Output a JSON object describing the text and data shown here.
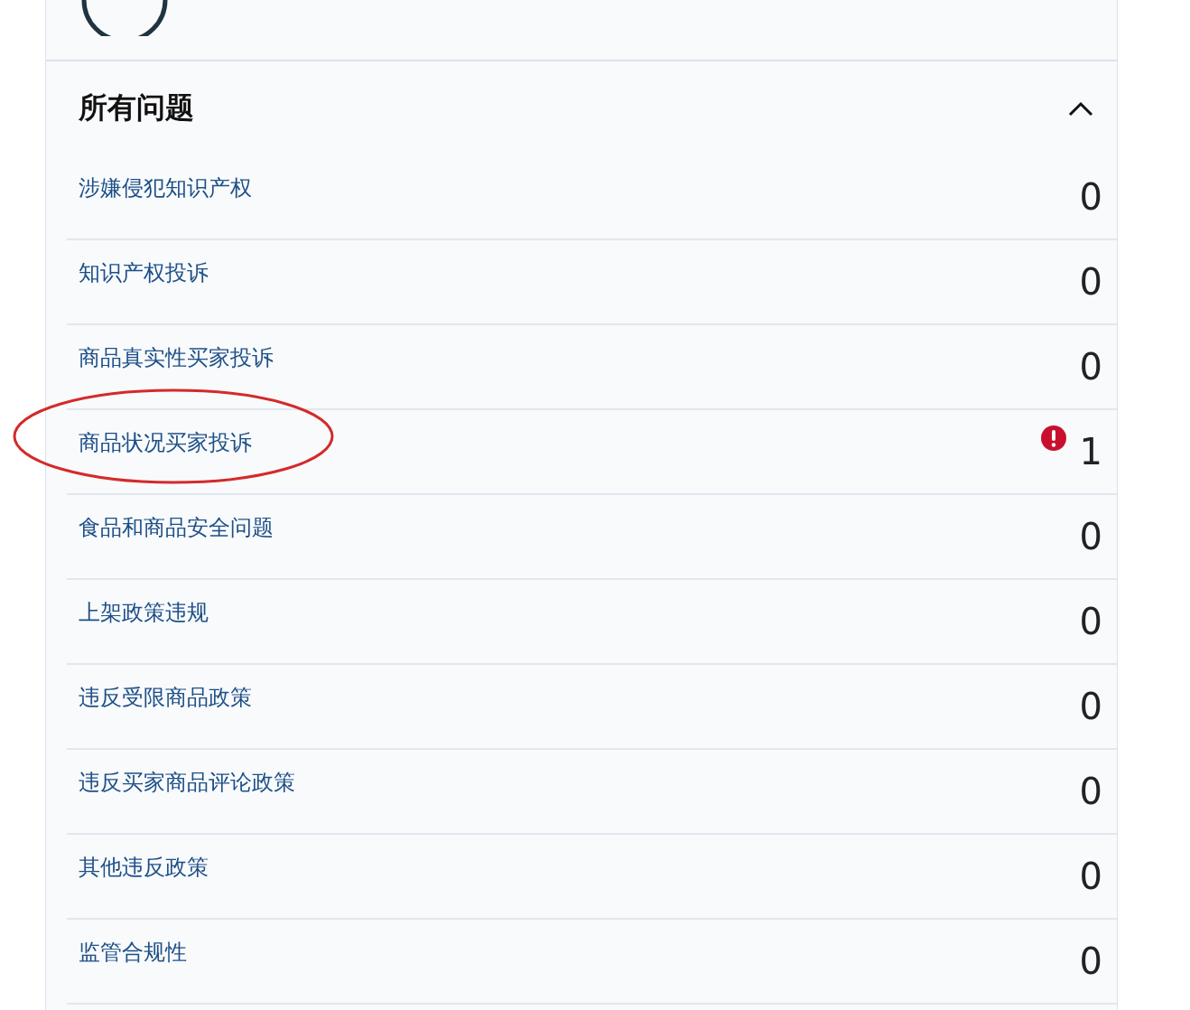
{
  "section": {
    "title": "所有问题",
    "expanded": true
  },
  "items": [
    {
      "label": "涉嫌侵犯知识产权",
      "count": "0",
      "alert": false,
      "circled": false
    },
    {
      "label": "知识产权投诉",
      "count": "0",
      "alert": false,
      "circled": false
    },
    {
      "label": "商品真实性买家投诉",
      "count": "0",
      "alert": false,
      "circled": false
    },
    {
      "label": "商品状况买家投诉",
      "count": "1",
      "alert": true,
      "circled": true
    },
    {
      "label": "食品和商品安全问题",
      "count": "0",
      "alert": false,
      "circled": false
    },
    {
      "label": "上架政策违规",
      "count": "0",
      "alert": false,
      "circled": false
    },
    {
      "label": "违反受限商品政策",
      "count": "0",
      "alert": false,
      "circled": false
    },
    {
      "label": "违反买家商品评论政策",
      "count": "0",
      "alert": false,
      "circled": false
    },
    {
      "label": "其他违反政策",
      "count": "0",
      "alert": false,
      "circled": false
    },
    {
      "label": "监管合规性",
      "count": "0",
      "alert": false,
      "circled": false
    }
  ]
}
